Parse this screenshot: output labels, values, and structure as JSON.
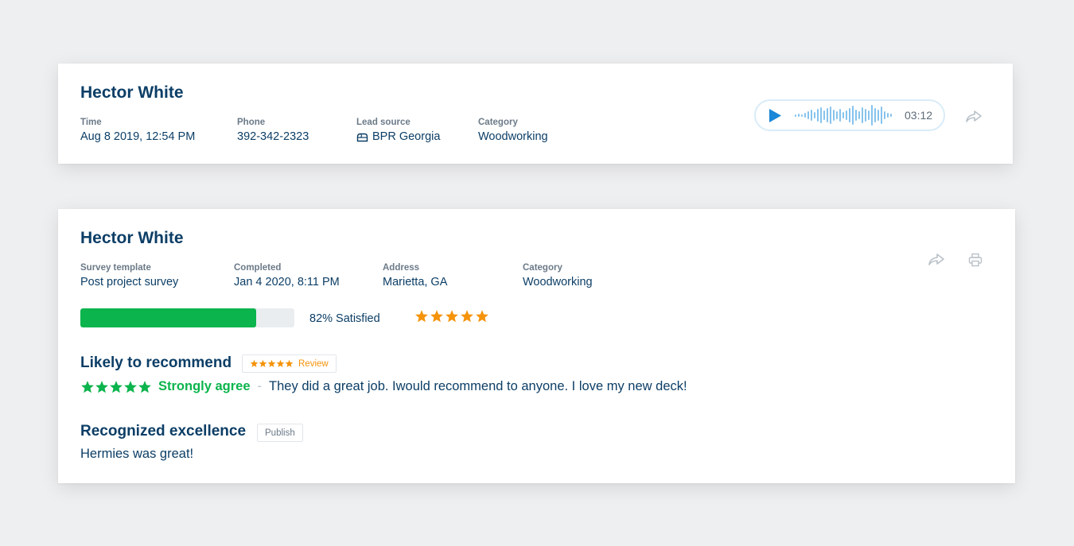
{
  "call_card": {
    "name": "Hector White",
    "fields": [
      {
        "label": "Time",
        "value": "Aug 8 2019, 12:54 PM"
      },
      {
        "label": "Phone",
        "value": "392-342-2323"
      },
      {
        "label": "Lead source",
        "value": "BPR Georgia",
        "icon": "mailbox-icon"
      },
      {
        "label": "Category",
        "value": "Woodworking"
      }
    ],
    "player": {
      "duration": "03:12",
      "icon": "play-icon"
    },
    "share_icon": "share-icon"
  },
  "survey_card": {
    "name": "Hector White",
    "fields": [
      {
        "label": "Survey template",
        "value": "Post project survey"
      },
      {
        "label": "Completed",
        "value": "Jan 4 2020, 8:11 PM"
      },
      {
        "label": "Address",
        "value": "Marietta, GA"
      },
      {
        "label": "Category",
        "value": "Woodworking"
      }
    ],
    "satisfaction": {
      "percent": 82,
      "label": "82% Satisfied",
      "stars": 5
    },
    "recommend": {
      "title": "Likely to recommend",
      "tag_label": "Review",
      "tag_stars": 5,
      "rating_stars": 5,
      "rating_label": "Strongly agree",
      "separator": "-",
      "comment": "They did a great job. Iwould recommend to anyone. I love my new deck!"
    },
    "excellence": {
      "title": "Recognized excellence",
      "tag_label": "Publish",
      "text": "Hermies was great!"
    },
    "icons": [
      "share-icon",
      "print-icon"
    ]
  },
  "colors": {
    "navy": "#0c3e66",
    "green": "#0bb44c",
    "orange": "#f5930b",
    "blue": "#1a87d8"
  }
}
